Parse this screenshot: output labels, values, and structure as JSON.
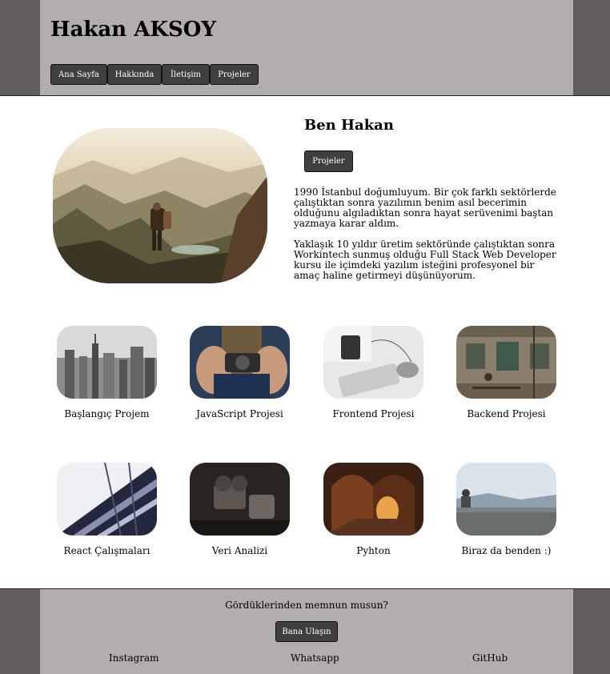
{
  "header": {
    "title": "Hakan AKSOY",
    "nav": [
      "Ana Sayfa",
      "Hakkında",
      "İletişim",
      "Projeler"
    ]
  },
  "about": {
    "heading": "Ben Hakan",
    "button": "Projeler",
    "paragraphs": [
      "1990 İstanbul doğumluyum. Bir çok farklı sektörlerde çalıştıktan sonra yazılımın benim asıl becerimin olduğunu algıladıktan sonra hayat serüvenimi baştan yazmaya karar aldım.",
      "Yaklaşık 10 yıldır üretim sektöründe çalıştıktan sonra Workintech sunmuş olduğu Full Stack Web Developer kursu ile içimdeki yazılım isteğini profesyonel bir amaç haline getirmeyi düşünüyorum."
    ]
  },
  "projects": [
    "Başlangıç Projem",
    "JavaScript Projesi",
    "Frontend Projesi",
    "Backend Projesi",
    "React Çalışmaları",
    "Veri Analizi",
    "Pyhton",
    "Biraz da benden :)"
  ],
  "footer": {
    "question": "Gördüklerinden memnun musun?",
    "button": "Bana Ulaşın",
    "links": [
      "Instagram",
      "Whatsapp",
      "GitHub"
    ]
  },
  "colors": {
    "side_band": "#615d5d",
    "header_bg": "#b3adad",
    "button_bg": "#403f3f"
  }
}
